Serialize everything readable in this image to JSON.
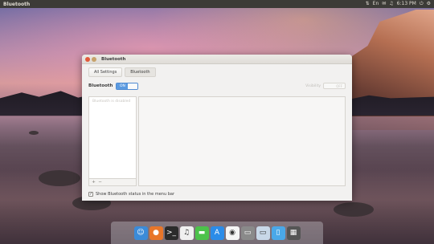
{
  "top_panel": {
    "app_title": "Bluetooth",
    "indicators": [
      "⇅",
      "En",
      "✉",
      "♫",
      "⏻"
    ],
    "clock": "6:13 PM",
    "gear": "⚙"
  },
  "window": {
    "title": "Bluetooth",
    "toolbar": {
      "all_settings": "All Settings",
      "bluetooth": "Bluetooth"
    },
    "bluetooth_label": "Bluetooth",
    "switch_on": "ON",
    "visibility_label": "Visibility",
    "visibility_switch": "OFF",
    "devices_disabled": "Bluetooth is disabled",
    "add_symbol": "+",
    "remove_symbol": "−",
    "show_status_label": "Show Bluetooth status in the menu bar",
    "check": "✓"
  },
  "dock": {
    "icons": [
      {
        "name": "finder-icon",
        "glyph": "☺",
        "color": "#3b8bd8"
      },
      {
        "name": "firefox-icon",
        "glyph": "●",
        "color": "#e8762a"
      },
      {
        "name": "terminal-icon",
        "glyph": ">_",
        "color": "#2b2b2b"
      },
      {
        "name": "music-icon",
        "glyph": "♫",
        "color": "#f0f0f0"
      },
      {
        "name": "messages-icon",
        "glyph": "▬",
        "color": "#4cc24a"
      },
      {
        "name": "appstore-icon",
        "glyph": "A",
        "color": "#2b8ce8"
      },
      {
        "name": "photos-icon",
        "glyph": "◉",
        "color": "#f5f5f5"
      },
      {
        "name": "desktop-icon",
        "glyph": "▭",
        "color": "#8a8a8a"
      },
      {
        "name": "screen-icon",
        "glyph": "▭",
        "color": "#c8d8e8"
      },
      {
        "name": "files-icon",
        "glyph": "▯",
        "color": "#4aa8e8"
      },
      {
        "name": "workspaces-icon",
        "glyph": "▦",
        "color": "#555555"
      }
    ]
  }
}
